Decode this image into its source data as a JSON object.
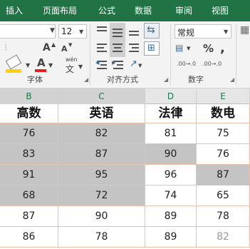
{
  "menu": {
    "tabs": [
      "插入",
      "页面布局",
      "公式",
      "数据",
      "审阅",
      "视图"
    ]
  },
  "ribbon": {
    "font_size": "12",
    "font_grow_label": "A",
    "font_shrink_label": "A",
    "phonetic_label": "wén",
    "phonetic_char": "文",
    "font_color_label": "A",
    "number_format": "常规",
    "percent_label": "%",
    "comma_label": ",",
    "decimal_inc_label": ".00→.0",
    "decimal_dec_label": ".00→.0",
    "groups": {
      "font": "字体",
      "alignment": "对齐方式",
      "number": "数字"
    },
    "colors": {
      "fill": "#ffd200",
      "font_color": "#e2231a",
      "accent": "#217346"
    }
  },
  "columns": [
    {
      "letter": "B",
      "active": true
    },
    {
      "letter": "C",
      "active": true
    },
    {
      "letter": "D",
      "active": false
    },
    {
      "letter": "E",
      "active": false
    }
  ],
  "table": {
    "headers": [
      "高数",
      "英语",
      "法律",
      "数电"
    ],
    "rows": [
      [
        "76",
        "82",
        "81",
        "75"
      ],
      [
        "83",
        "87",
        "90",
        "76"
      ],
      [
        "91",
        "95",
        "96",
        "87"
      ],
      [
        "68",
        "72",
        "74",
        "65"
      ],
      [
        "87",
        "90",
        "89",
        "78"
      ],
      [
        "86",
        "78",
        "89",
        "82"
      ]
    ],
    "highlighted_cells": [
      [
        0,
        0
      ],
      [
        0,
        1
      ],
      [
        1,
        0
      ],
      [
        1,
        1
      ],
      [
        1,
        2
      ],
      [
        2,
        0
      ],
      [
        2,
        1
      ],
      [
        2,
        3
      ],
      [
        3,
        0
      ],
      [
        3,
        1
      ]
    ],
    "highlight_color": "#c4c4c4"
  }
}
